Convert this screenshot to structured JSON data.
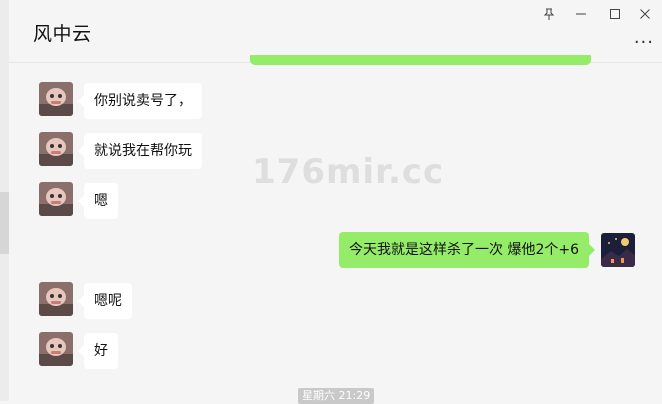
{
  "chat": {
    "title": "风中云",
    "more": "···"
  },
  "window_controls": {
    "pin": "⚲",
    "minimize": "—",
    "maximize": "☐",
    "close": "✕"
  },
  "messages": [
    {
      "side": "in",
      "text": "你别说卖号了，"
    },
    {
      "side": "in",
      "text": "就说我在帮你玩"
    },
    {
      "side": "in",
      "text": "嗯"
    },
    {
      "side": "out",
      "text": "今天我就是这样杀了一次  爆他2个+6"
    },
    {
      "side": "in",
      "text": "嗯呢"
    },
    {
      "side": "in",
      "text": "好"
    }
  ],
  "watermark": "176mir.cc",
  "time_label": "星期六 21:29",
  "colors": {
    "out_bubble": "#95ec69",
    "in_bubble": "#ffffff",
    "background": "#f5f5f5"
  }
}
